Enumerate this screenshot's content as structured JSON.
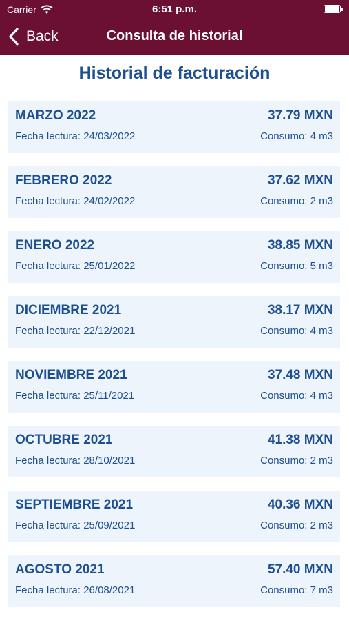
{
  "status_bar": {
    "carrier": "Carrier",
    "time": "6:51 p.m."
  },
  "nav": {
    "back_label": "Back",
    "title": "Consulta de historial"
  },
  "page": {
    "title": "Historial de facturación"
  },
  "colors": {
    "header_bg": "#6b0f33",
    "accent_text": "#1d4f91",
    "card_bg": "#edf4fb"
  },
  "history": [
    {
      "month": "MARZO 2022",
      "amount": "37.79 MXN",
      "date": "Fecha lectura: 24/03/2022",
      "consumo": "Consumo: 4 m3"
    },
    {
      "month": "FEBRERO 2022",
      "amount": "37.62 MXN",
      "date": "Fecha lectura: 24/02/2022",
      "consumo": "Consumo: 2 m3"
    },
    {
      "month": "ENERO 2022",
      "amount": "38.85 MXN",
      "date": "Fecha lectura: 25/01/2022",
      "consumo": "Consumo: 5 m3"
    },
    {
      "month": "DICIEMBRE 2021",
      "amount": "38.17 MXN",
      "date": "Fecha lectura: 22/12/2021",
      "consumo": "Consumo: 4 m3"
    },
    {
      "month": "NOVIEMBRE 2021",
      "amount": "37.48 MXN",
      "date": "Fecha lectura: 25/11/2021",
      "consumo": "Consumo: 4 m3"
    },
    {
      "month": "OCTUBRE 2021",
      "amount": "41.38 MXN",
      "date": "Fecha lectura: 28/10/2021",
      "consumo": "Consumo: 2 m3"
    },
    {
      "month": "SEPTIEMBRE 2021",
      "amount": "40.36 MXN",
      "date": "Fecha lectura: 25/09/2021",
      "consumo": "Consumo: 2 m3"
    },
    {
      "month": "AGOSTO 2021",
      "amount": "57.40 MXN",
      "date": "Fecha lectura: 26/08/2021",
      "consumo": "Consumo: 7 m3"
    }
  ]
}
